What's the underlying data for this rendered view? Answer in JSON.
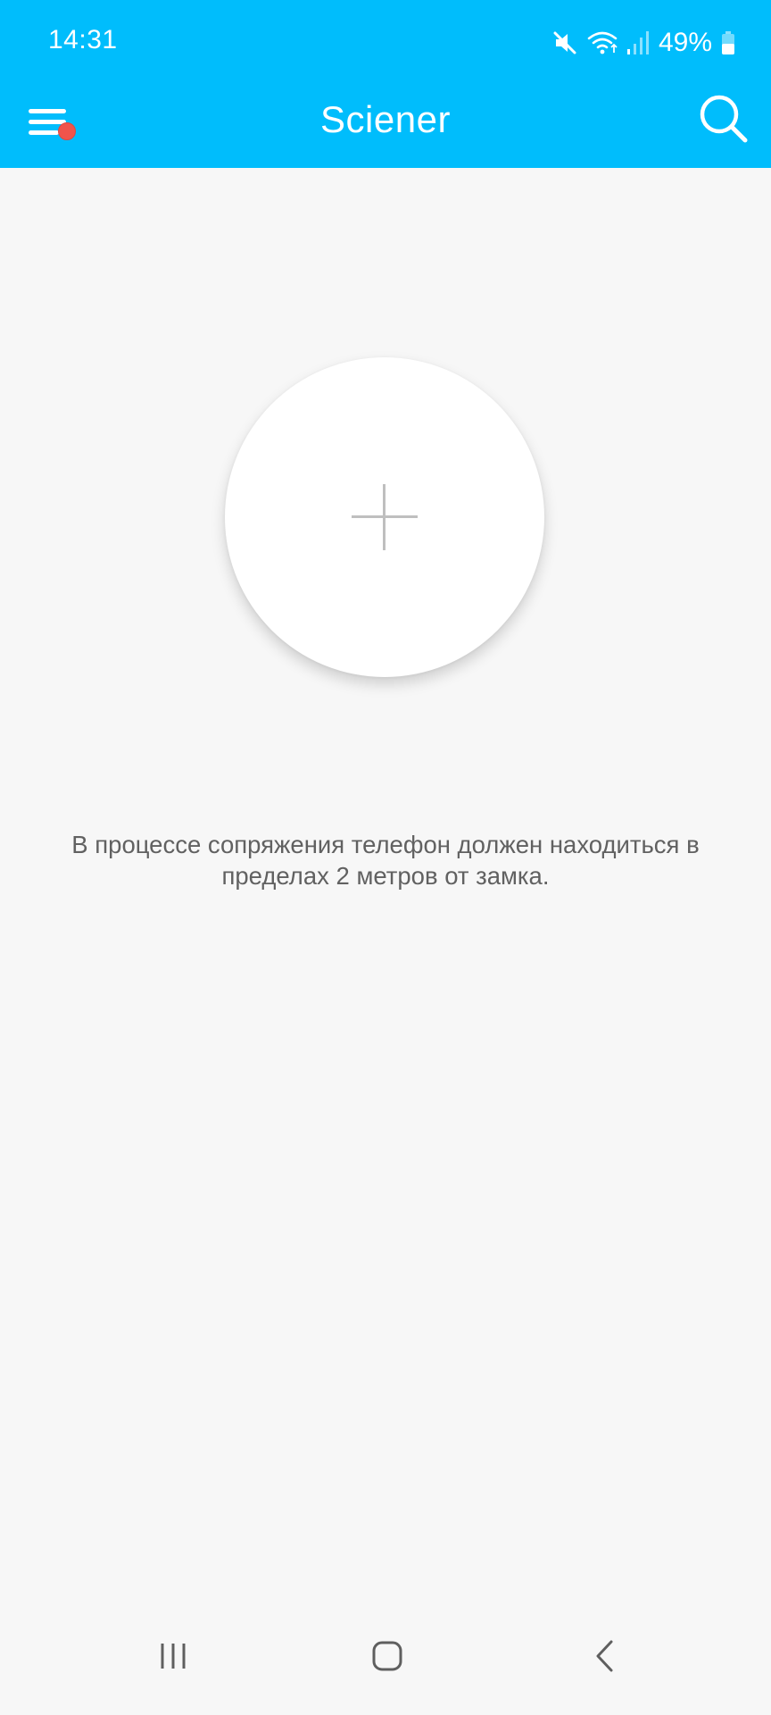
{
  "status_bar": {
    "time": "14:31",
    "battery_percent": "49%",
    "icons": [
      "mute-icon",
      "wifi-icon",
      "signal-icon",
      "battery-icon"
    ],
    "battery_level": 0.49
  },
  "header": {
    "title": "Sciener",
    "menu_icon": "menu-icon",
    "notification_dot_color": "#f0544b",
    "search_icon": "search-icon",
    "background_color": "#00bdfc"
  },
  "main": {
    "add_button_icon": "plus-icon",
    "hint": "В процессе сопряжения телефон должен находиться в пределах 2 метров от замка."
  },
  "nav_bar": {
    "buttons": [
      "recent-apps-icon",
      "home-icon",
      "back-icon"
    ]
  }
}
